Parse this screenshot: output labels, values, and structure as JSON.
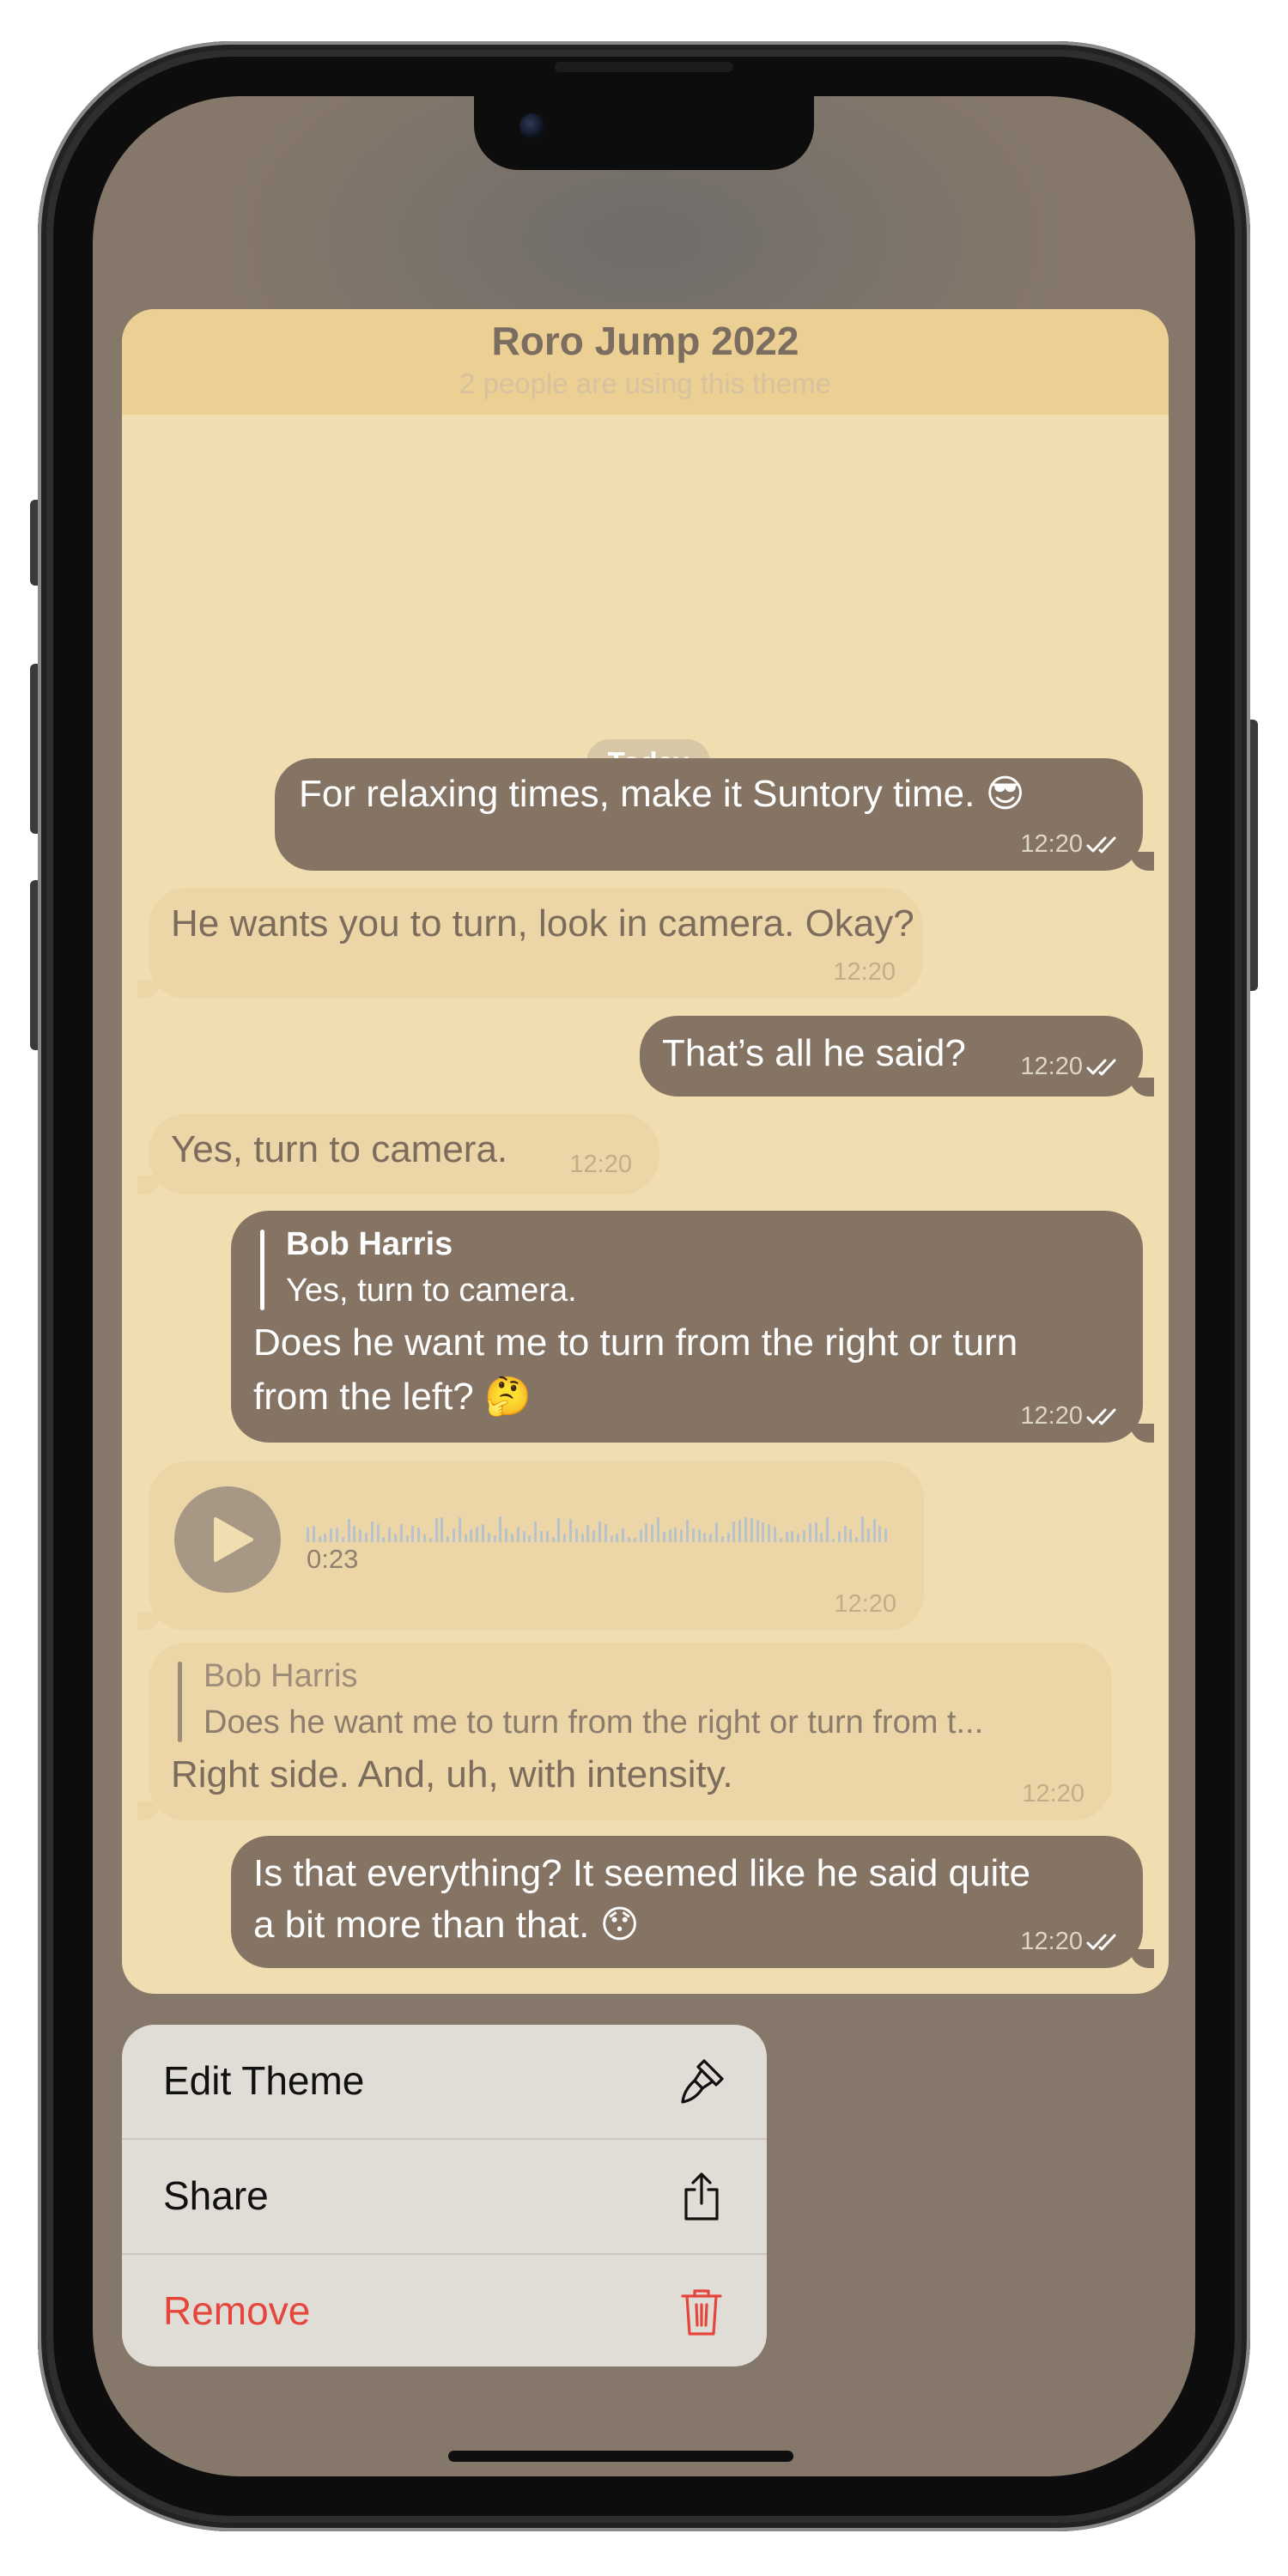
{
  "theme_preview": {
    "title": "Roro Jump 2022",
    "subtitle": "2 people are using this theme",
    "date_separator": "Today"
  },
  "messages": [
    {
      "direction": "outgoing",
      "text": "For relaxing times, make it Suntory time. 😎",
      "time": "12:20",
      "read": true
    },
    {
      "direction": "incoming",
      "text": "He wants you to turn, look in camera. Okay?",
      "time": "12:20"
    },
    {
      "direction": "outgoing",
      "text": "That’s all he said?",
      "time": "12:20",
      "read": true
    },
    {
      "direction": "incoming",
      "text": "Yes, turn to camera.",
      "time": "12:20"
    },
    {
      "direction": "outgoing",
      "reply_to": {
        "name": "Bob Harris",
        "text": "Yes, turn to camera."
      },
      "lines": [
        "Does he want me to turn from the right or turn",
        "from the left? 🤔"
      ],
      "time": "12:20",
      "read": true
    },
    {
      "direction": "incoming",
      "type": "voice",
      "duration": "0:23",
      "time": "12:20"
    },
    {
      "direction": "incoming",
      "reply_to": {
        "name": "Bob Harris",
        "text": "Does he want me to turn from the right or turn from t..."
      },
      "text": "Right side. And, uh, with intensity.",
      "time": "12:20"
    },
    {
      "direction": "outgoing",
      "lines": [
        "Is that everything? It seemed like he said quite",
        "a bit more than that. 😯"
      ],
      "time": "12:20",
      "read": true
    }
  ],
  "menu": {
    "items": [
      {
        "label": "Edit Theme",
        "icon": "brush-icon"
      },
      {
        "label": "Share",
        "icon": "share-icon"
      },
      {
        "label": "Remove",
        "icon": "trash-icon",
        "destructive": true
      }
    ]
  },
  "colors": {
    "outgoing_bubble": "#857464",
    "incoming_bubble": "#ecd6a8",
    "chat_background": "#f1deb0",
    "header_background": "#ebcf93",
    "destructive": "#e5463c",
    "dimmed_background": "#85786a"
  }
}
